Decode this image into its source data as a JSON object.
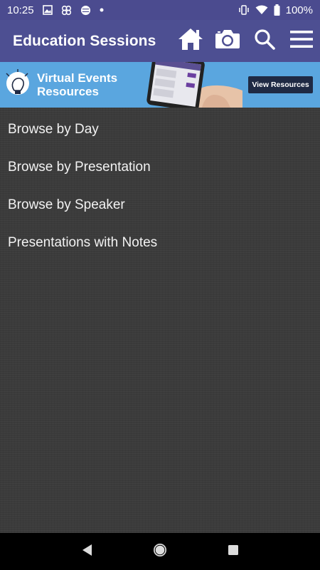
{
  "status_bar": {
    "time": "10:25",
    "battery": "100%",
    "icons": [
      "image-icon",
      "pinwheel-icon",
      "globe-icon",
      "dot-icon",
      "vibrate-icon",
      "wifi-icon",
      "battery-icon"
    ]
  },
  "app_bar": {
    "title": "Education Sessions",
    "actions": [
      "home-icon",
      "camera-icon",
      "search-icon",
      "menu-icon"
    ],
    "background": "#4d4f92"
  },
  "banner": {
    "line1": "Virtual Events",
    "line2": "Resources",
    "button_label": "View Resources",
    "background": "#5aa6df"
  },
  "menu": {
    "items": [
      {
        "label": "Browse by Day"
      },
      {
        "label": "Browse by Presentation"
      },
      {
        "label": "Browse by Speaker"
      },
      {
        "label": "Presentations with Notes"
      }
    ]
  },
  "nav_bar": {
    "buttons": [
      "back-icon",
      "home-circle-icon",
      "recents-icon"
    ]
  }
}
